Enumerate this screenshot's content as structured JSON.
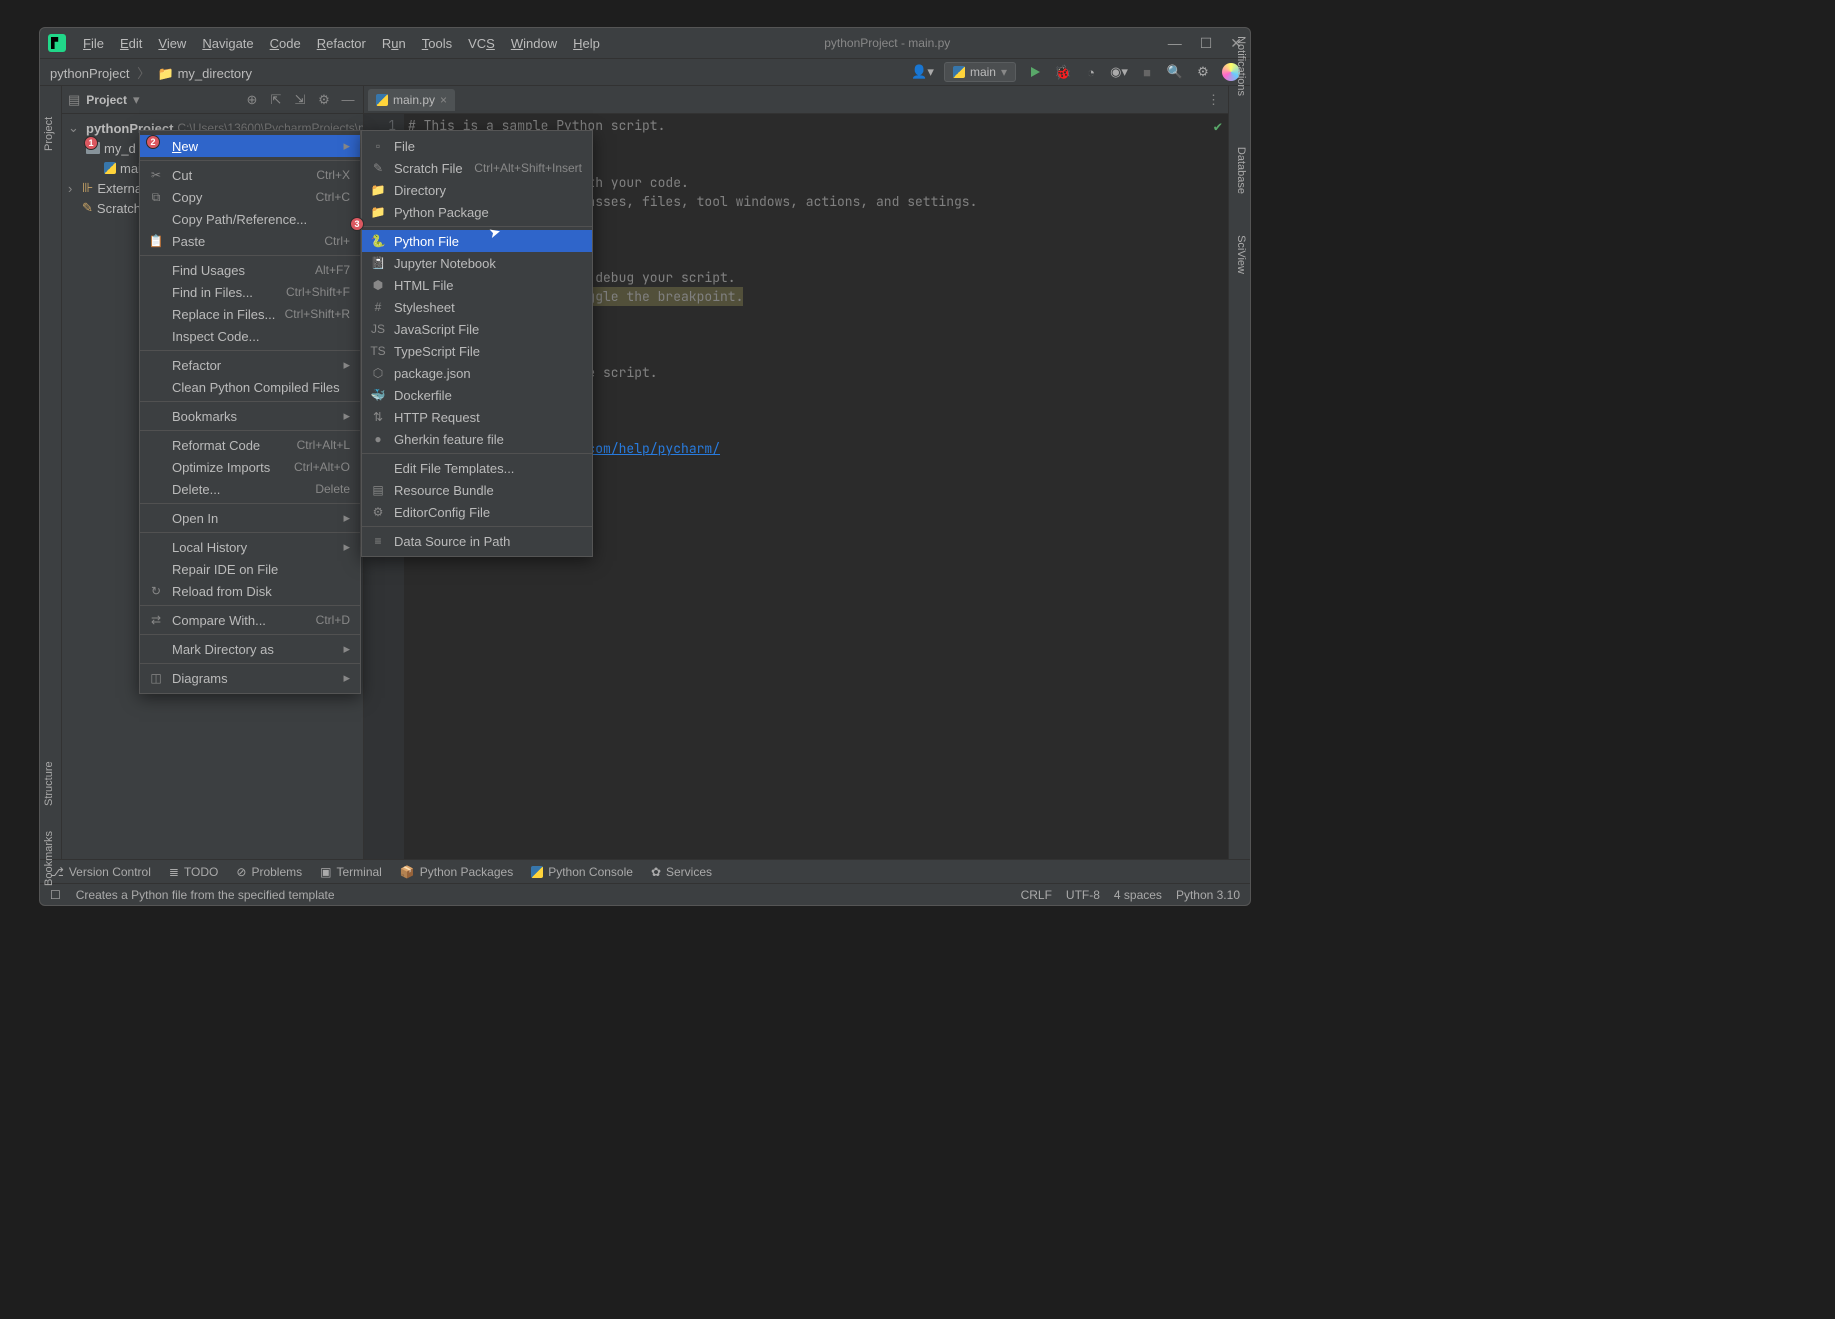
{
  "window": {
    "title": "pythonProject - main.py",
    "menus": [
      "File",
      "Edit",
      "View",
      "Navigate",
      "Code",
      "Refactor",
      "Run",
      "Tools",
      "VCS",
      "Window",
      "Help"
    ]
  },
  "breadcrumb": {
    "parts": [
      "pythonProject",
      "my_directory"
    ]
  },
  "runcfg": {
    "label": "main"
  },
  "toolbar_icons": [
    "run",
    "debug",
    "coverage",
    "profile",
    "more",
    "stop",
    "search",
    "settings",
    "avatar"
  ],
  "project_panel": {
    "title": "Project",
    "tree": {
      "root": {
        "name": "pythonProject",
        "path": "C:\\Users\\13600\\PycharmProjects\\py"
      },
      "dir": {
        "name": "my_d"
      },
      "file": {
        "name": "main"
      },
      "ext_libs": "External",
      "scratches": "Scratche"
    }
  },
  "tabs": [
    {
      "label": "main.py"
    }
  ],
  "editor": {
    "line_numbers": [
      "1"
    ],
    "lines": [
      "# This is a sample Python script.",
      "",
      "",
      "ute it or replace it with your code.",
      "earch everywhere for classes, files, tool windows, actions, and settings.",
      "",
      "",
      "",
      " the code line below to debug your script.",
      "# Press Ctrl+F8 to toggle the breakpoint.",
      "",
      "",
      "",
      "in the gutter to run the script.",
      ":",
      "",
      "",
      "https://www.jetbrains.com/help/pycharm/"
    ]
  },
  "context_menu": {
    "items": [
      {
        "type": "item",
        "label": "New",
        "shortcut": "",
        "submenu": true,
        "icon": "",
        "selected": true
      },
      {
        "type": "sep"
      },
      {
        "type": "item",
        "label": "Cut",
        "shortcut": "Ctrl+X",
        "icon": "✂"
      },
      {
        "type": "item",
        "label": "Copy",
        "shortcut": "Ctrl+C",
        "icon": "⧉"
      },
      {
        "type": "item",
        "label": "Copy Path/Reference...",
        "shortcut": ""
      },
      {
        "type": "item",
        "label": "Paste",
        "shortcut": "Ctrl+",
        "icon": "📋"
      },
      {
        "type": "sep"
      },
      {
        "type": "item",
        "label": "Find Usages",
        "shortcut": "Alt+F7"
      },
      {
        "type": "item",
        "label": "Find in Files...",
        "shortcut": "Ctrl+Shift+F"
      },
      {
        "type": "item",
        "label": "Replace in Files...",
        "shortcut": "Ctrl+Shift+R"
      },
      {
        "type": "item",
        "label": "Inspect Code...",
        "shortcut": ""
      },
      {
        "type": "sep"
      },
      {
        "type": "item",
        "label": "Refactor",
        "submenu": true
      },
      {
        "type": "item",
        "label": "Clean Python Compiled Files"
      },
      {
        "type": "sep"
      },
      {
        "type": "item",
        "label": "Bookmarks",
        "submenu": true
      },
      {
        "type": "sep"
      },
      {
        "type": "item",
        "label": "Reformat Code",
        "shortcut": "Ctrl+Alt+L"
      },
      {
        "type": "item",
        "label": "Optimize Imports",
        "shortcut": "Ctrl+Alt+O"
      },
      {
        "type": "item",
        "label": "Delete...",
        "shortcut": "Delete"
      },
      {
        "type": "sep"
      },
      {
        "type": "item",
        "label": "Open In",
        "submenu": true
      },
      {
        "type": "sep"
      },
      {
        "type": "item",
        "label": "Local History",
        "submenu": true
      },
      {
        "type": "item",
        "label": "Repair IDE on File"
      },
      {
        "type": "item",
        "label": "Reload from Disk",
        "icon": "↻"
      },
      {
        "type": "sep"
      },
      {
        "type": "item",
        "label": "Compare With...",
        "shortcut": "Ctrl+D",
        "icon": "⇄"
      },
      {
        "type": "sep"
      },
      {
        "type": "item",
        "label": "Mark Directory as",
        "submenu": true
      },
      {
        "type": "sep"
      },
      {
        "type": "item",
        "label": "Diagrams",
        "submenu": true,
        "icon": "◫"
      }
    ]
  },
  "new_submenu": {
    "items": [
      {
        "label": "File",
        "icon": "file"
      },
      {
        "label": "Scratch File",
        "shortcut": "Ctrl+Alt+Shift+Insert",
        "icon": "scratch"
      },
      {
        "label": "Directory",
        "icon": "folder"
      },
      {
        "label": "Python Package",
        "icon": "folder-py"
      },
      {
        "sep": true
      },
      {
        "label": "Python File",
        "icon": "py",
        "selected": true
      },
      {
        "label": "Jupyter Notebook",
        "icon": "jupyter"
      },
      {
        "label": "HTML File",
        "icon": "html"
      },
      {
        "label": "Stylesheet",
        "icon": "css"
      },
      {
        "label": "JavaScript File",
        "icon": "js"
      },
      {
        "label": "TypeScript File",
        "icon": "ts"
      },
      {
        "label": "package.json",
        "icon": "npm"
      },
      {
        "label": "Dockerfile",
        "icon": "docker"
      },
      {
        "label": "HTTP Request",
        "icon": "http"
      },
      {
        "label": "Gherkin feature file",
        "icon": "gherkin"
      },
      {
        "sep": true
      },
      {
        "label": "Edit File Templates..."
      },
      {
        "label": "Resource Bundle",
        "icon": "bundle"
      },
      {
        "label": "EditorConfig File",
        "icon": "editorconfig"
      },
      {
        "sep": true
      },
      {
        "label": "Data Source in Path",
        "icon": "db"
      }
    ]
  },
  "bottombar": {
    "items": [
      "Version Control",
      "TODO",
      "Problems",
      "Terminal",
      "Python Packages",
      "Python Console",
      "Services"
    ]
  },
  "statusbar": {
    "hint": "Creates a Python file from the specified template",
    "right": [
      "CRLF",
      "UTF-8",
      "4 spaces",
      "Python 3.10"
    ]
  },
  "side_tools": {
    "left": [
      "Project",
      "Structure",
      "Bookmarks"
    ],
    "right": [
      "Notifications",
      "Database",
      "SciView"
    ]
  },
  "markers": [
    "1",
    "2",
    "3"
  ]
}
